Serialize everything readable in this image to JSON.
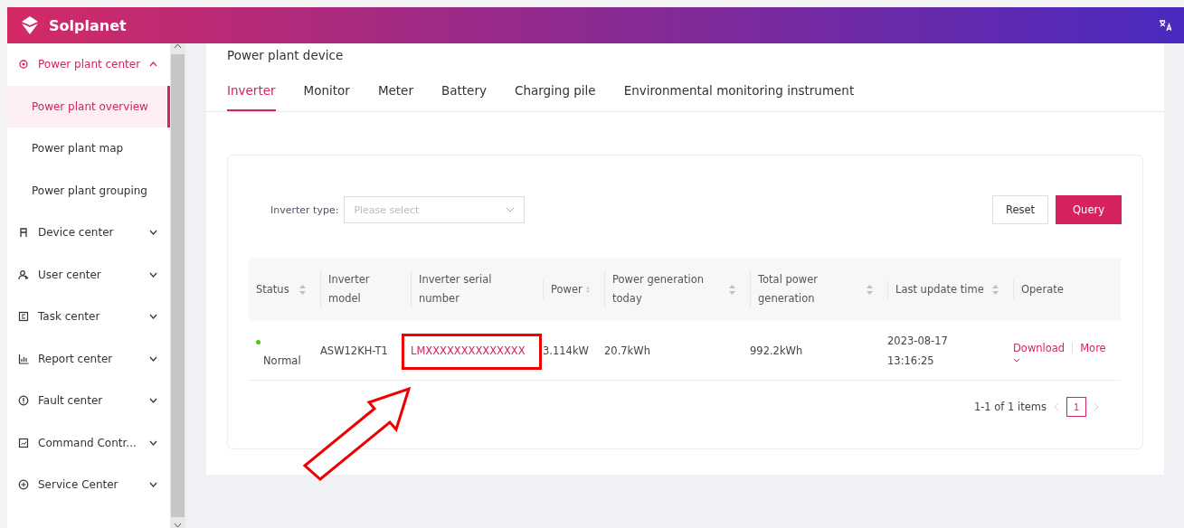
{
  "header": {
    "brand": "Solplanet"
  },
  "sidebar": {
    "items": [
      {
        "label": "Power plant center",
        "expanded": true,
        "selected": false,
        "children": [
          {
            "label": "Power plant overview",
            "selected": true
          },
          {
            "label": "Power plant map",
            "selected": false
          },
          {
            "label": "Power plant grouping",
            "selected": false
          }
        ]
      },
      {
        "label": "Device center",
        "expanded": false,
        "selected": false
      },
      {
        "label": "User center",
        "expanded": false,
        "selected": false
      },
      {
        "label": "Task center",
        "expanded": false,
        "selected": false
      },
      {
        "label": "Report center",
        "expanded": false,
        "selected": false
      },
      {
        "label": "Fault center",
        "expanded": false,
        "selected": false
      },
      {
        "label": "Command Contr...",
        "expanded": false,
        "selected": false
      },
      {
        "label": "Service Center",
        "expanded": false,
        "selected": false
      }
    ]
  },
  "page": {
    "title": "Power plant device"
  },
  "tabs": [
    {
      "label": "Inverter",
      "selected": true
    },
    {
      "label": "Monitor",
      "selected": false
    },
    {
      "label": "Meter",
      "selected": false
    },
    {
      "label": "Battery",
      "selected": false
    },
    {
      "label": "Charging pile",
      "selected": false
    },
    {
      "label": "Environmental monitoring instrument",
      "selected": false
    }
  ],
  "filter": {
    "label": "Inverter type:",
    "placeholder": "Please select"
  },
  "buttons": [
    {
      "label": "Reset",
      "kind": "default"
    },
    {
      "label": "Query",
      "kind": "primary"
    }
  ],
  "table": {
    "columns": [
      {
        "label": "Status",
        "sortable": true
      },
      {
        "label": "Inverter model",
        "sortable": false
      },
      {
        "label": "Inverter serial number",
        "sortable": false
      },
      {
        "label": "Power",
        "sortable": true
      },
      {
        "label": "Power generation today",
        "sortable": true
      },
      {
        "label": "Total power generation",
        "sortable": true
      },
      {
        "label": "Last update time",
        "sortable": true
      },
      {
        "label": "Operate",
        "sortable": false
      }
    ],
    "rows": [
      {
        "status": "Normal",
        "online": true,
        "model": "ASW12KH-T1",
        "serial": "LMXXXXXXXXXXXXXX",
        "power": "3.114kW",
        "today": "20.7kWh",
        "total": "992.2kWh",
        "updated": "2023-08-17 13:16:25",
        "actions": [
          "Download",
          "More"
        ]
      }
    ]
  },
  "pagination": {
    "summary": "1-1 of 1 items",
    "pages": [
      {
        "label": "1",
        "selected": true
      }
    ]
  },
  "annotation": {
    "highlight": true,
    "arrow": true
  }
}
